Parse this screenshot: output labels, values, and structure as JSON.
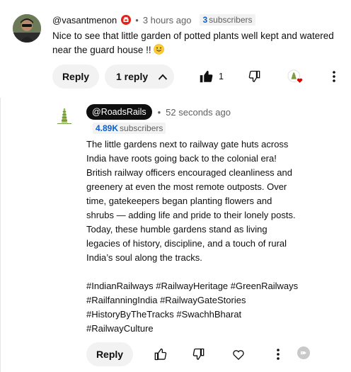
{
  "top_comment": {
    "author": "@vasantmenon",
    "timestamp": "3 hours ago",
    "subscriber_count": "3",
    "subscriber_word": "subscribers",
    "text": "Nice to see that little garden of potted plants well kept and watered near the guard house !!",
    "reply_label": "Reply",
    "replies_toggle_label": "1 reply",
    "like_count": "1",
    "icons": [
      "yt-member-badge",
      "smile-emoji",
      "thumbs-up-filled-icon",
      "thumbs-down-icon",
      "creator-heart-badge",
      "more-vert-icon",
      "chevron-up-icon"
    ]
  },
  "reply": {
    "author": "@RoadsRails",
    "timestamp": "52 seconds ago",
    "subscriber_count": "4.89K",
    "subscriber_word": "subscribers",
    "body_lines": [
      "The little gardens next to railway gate huts across",
      "India have roots going back to the colonial era!",
      "British railway officers encouraged cleanliness and",
      "greenery at even the most remote outposts. Over",
      "time, gatekeepers began planting flowers and",
      "shrubs — adding life and pride to their lonely posts.",
      "Today, these humble gardens stand as living",
      "legacies of history, discipline, and a touch of rural",
      "India’s soul along the tracks."
    ],
    "hashtag_lines": [
      "#IndianRailways #RailwayHeritage #GreenRailways",
      "#RailfanningIndia #RailwayGateStories",
      "#HistoryByTheTracks #SwachhBharat",
      "#RailwayCulture"
    ],
    "reply_label": "Reply",
    "icons": [
      "thumbs-up-icon",
      "thumbs-down-icon",
      "heart-icon",
      "more-vert-icon",
      "tag-icon"
    ]
  },
  "colors": {
    "accent_blue": "#065fd4",
    "badge_bg": "#f2f2f2",
    "pill_bg": "#f2f2f2",
    "channel_pill_bg": "#0f0f0f",
    "heart_red": "#e00000"
  }
}
